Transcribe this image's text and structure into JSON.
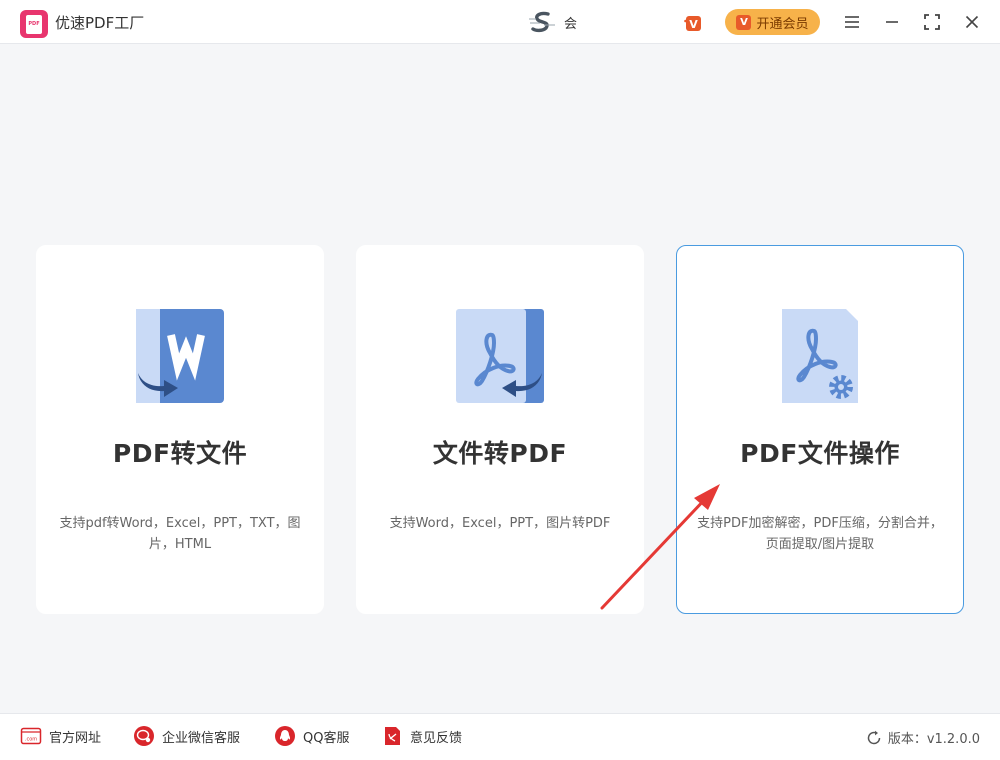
{
  "app": {
    "title": "优速PDF工厂",
    "logo_text": "PDF"
  },
  "header": {
    "user_name": "会",
    "vip_button_label": "开通会员",
    "vip_badge_letter": "V"
  },
  "cards": [
    {
      "title": "PDF转文件",
      "desc": "支持pdf转Word，Excel，PPT，TXT，图片，HTML",
      "icon": "word-convert-icon"
    },
    {
      "title": "文件转PDF",
      "desc": "支持Word，Excel，PPT，图片转PDF",
      "icon": "pdf-convert-icon"
    },
    {
      "title": "PDF文件操作",
      "desc": "支持PDF加密解密，PDF压缩，分割合并，页面提取/图片提取",
      "icon": "pdf-settings-icon"
    }
  ],
  "footer": {
    "website": "官方网址",
    "wechat": "企业微信客服",
    "qq": "QQ客服",
    "feedback": "意见反馈",
    "version": "版本：v1.2.0.0"
  },
  "colors": {
    "accent": "#4a9be0",
    "brand": "#e8356e",
    "icon_blue": "#5a88d0",
    "icon_light": "#c9daf6",
    "vip": "#f7b24a",
    "footer_red": "#d9262b"
  }
}
